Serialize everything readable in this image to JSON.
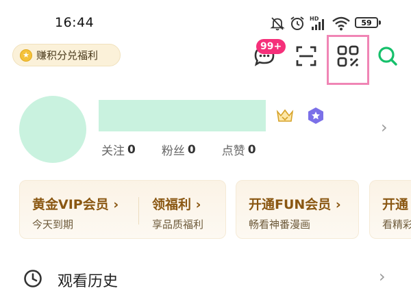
{
  "status_bar": {
    "time": "16:44",
    "icons": [
      "bell-muted-icon",
      "alarm-icon",
      "hd-signal-icon",
      "wifi-icon"
    ],
    "battery": "59"
  },
  "points": {
    "label": "赚积分兑福利",
    "icon": "coin-star-icon"
  },
  "header": {
    "message_badge": "99+",
    "icons": [
      "message-icon",
      "scan-icon",
      "qr-code-icon",
      "search-icon"
    ],
    "highlight_color": "#f085b5"
  },
  "profile": {
    "badges": [
      "crown-badge-icon",
      "hexagon-star-badge-icon"
    ],
    "stats": [
      {
        "label": "关注",
        "value": "0"
      },
      {
        "label": "粉丝",
        "value": "0"
      },
      {
        "label": "点赞",
        "value": "0"
      }
    ]
  },
  "vip_cards": [
    {
      "title": "黄金VIP会员",
      "subtitle": "今天到期",
      "right_title": "领福利",
      "right_subtitle": "享品质福利"
    },
    {
      "title": "开通FUN会员",
      "subtitle": "畅看神番漫画"
    },
    {
      "title": "开通",
      "subtitle": "看精彩"
    }
  ],
  "history": {
    "label": "观看历史"
  },
  "colors": {
    "accent_green": "#16c06b",
    "badge_pink": "#f5307a",
    "card_text_gold": "#8a5712",
    "placeholder_mint": "#c9f2df"
  }
}
